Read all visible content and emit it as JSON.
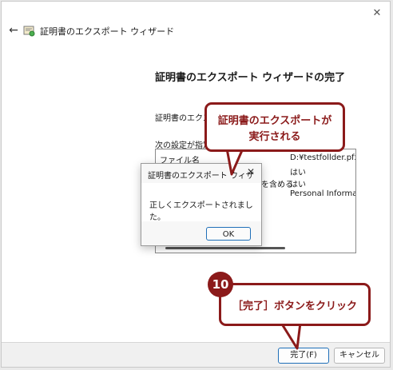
{
  "wizard": {
    "title": "証明書のエクスポート ウィザード",
    "close_glyph": "✕",
    "back_glyph": "←",
    "heading": "証明書のエクスポート ウィザードの完了",
    "lead_text": "証明書のエクスポ",
    "subtext": "次の設定が指定さ",
    "settings": [
      {
        "key": "ファイル名",
        "value": "D:¥testfollder.pfx"
      },
      {
        "key": "",
        "value": "はい"
      },
      {
        "key": "を含める",
        "value": "はい"
      },
      {
        "key": "",
        "value": "Personal Informatic"
      }
    ],
    "buttons": {
      "finish": "完了(F)",
      "cancel": "キャンセル"
    }
  },
  "message_box": {
    "title": "証明書のエクスポート ウィザード",
    "close_glyph": "✕",
    "message": "正しくエクスポートされました。",
    "ok": "OK"
  },
  "annotations": {
    "callout1_line1": "証明書のエクスポートが",
    "callout1_line2": "実行される",
    "step_number": "10",
    "callout2_text": "［完了］ボタンをクリック"
  },
  "colors": {
    "accent": "#8b1a1a",
    "focus_border": "#1f6fb8"
  },
  "icons": {
    "back": "back-arrow-icon",
    "cert": "certificate-icon"
  }
}
